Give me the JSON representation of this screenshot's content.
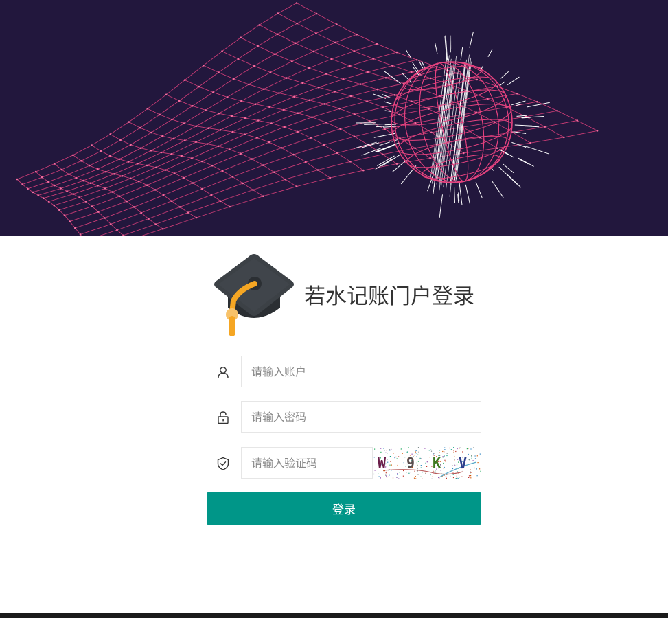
{
  "banner": {
    "background_color": "#22173d",
    "grid_color": "#e6427f",
    "ray_color": "#ffffff"
  },
  "brand": {
    "logo_icon": "graduation-cap-icon",
    "title": "若水记账门户登录"
  },
  "form": {
    "account": {
      "icon": "user-icon",
      "placeholder": "请输入账户",
      "value": ""
    },
    "password": {
      "icon": "lock-icon",
      "placeholder": "请输入密码",
      "value": ""
    },
    "captcha": {
      "icon": "shield-check-icon",
      "placeholder": "请输入验证码",
      "value": "",
      "image_text": "W9KV"
    },
    "submit_label": "登录"
  },
  "colors": {
    "primary": "#009688",
    "footer": "#1b1b1b"
  }
}
